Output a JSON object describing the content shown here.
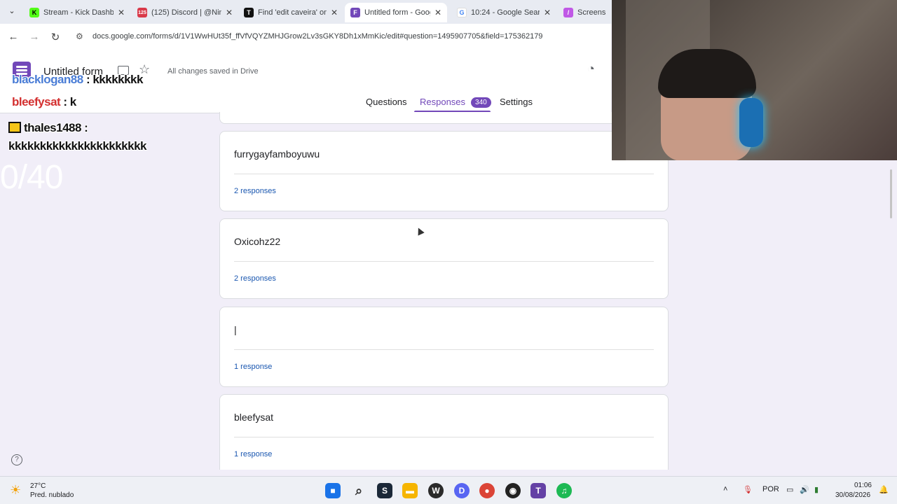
{
  "browser": {
    "tabs": [
      {
        "title": "Stream - Kick Dashbo",
        "fav_color": "#53fc18",
        "glyph": "K"
      },
      {
        "title": "(125) Discord | @Nin",
        "fav_color": "#d93a4a",
        "glyph": "125"
      },
      {
        "title": "Find 'edit caveira' on",
        "fav_color": "#111111",
        "glyph": "T"
      },
      {
        "title": "Untitled form - Goog",
        "fav_color": "#7248b9",
        "glyph": "F"
      },
      {
        "title": "10:24 - Google Searc",
        "fav_color": "#4285f4",
        "glyph": "G"
      },
      {
        "title": "Screenshot",
        "fav_color": "#c058e6",
        "glyph": "/"
      }
    ],
    "url": "docs.google.com/forms/d/1V1WwHUt35f_ffVfVQYZMHJGrow2Lv3sGKY8Dh1xMmKic/edit#question=1495907705&field=175362179"
  },
  "form": {
    "title": "Untitled form",
    "saved_status": "All changes saved in Drive",
    "tabs": {
      "questions": "Questions",
      "responses": "Responses",
      "responses_count": "340",
      "settings": "Settings"
    }
  },
  "overlay": {
    "chat": [
      {
        "user": "blacklogan88",
        "msg": " : kkkkkkkk"
      },
      {
        "user": "bleefysat",
        "msg": " : k"
      },
      {
        "user": "thales1488 :",
        "msg": "kkkkkkkkkkkkkkkkkkkkkk"
      }
    ],
    "goal": "0/40"
  },
  "responses": [
    {
      "question": "furrygayfamboyuwu",
      "count": "2 responses"
    },
    {
      "question": "Oxicohz22",
      "count": "2 responses"
    },
    {
      "question": "|",
      "count": "1 response"
    },
    {
      "question": "bleefysat",
      "count": "1 response"
    }
  ],
  "taskbar": {
    "temperature": "27°C",
    "condition": "Pred. nublado",
    "language": "POR",
    "time": "01:06",
    "date": "30/08/2026",
    "apps": [
      {
        "name": "windows-start",
        "color": "#1a73e8",
        "glyph": "■"
      },
      {
        "name": "search",
        "color": "#333333",
        "glyph": "⌕"
      },
      {
        "name": "steam",
        "color": "#1b2838",
        "glyph": "S"
      },
      {
        "name": "file-explorer",
        "color": "#f6b500",
        "glyph": "▬"
      },
      {
        "name": "wow",
        "color": "#2a2a2a",
        "glyph": "W"
      },
      {
        "name": "discord",
        "color": "#5865f2",
        "glyph": "D"
      },
      {
        "name": "chrome",
        "color": "#db4437",
        "glyph": "●"
      },
      {
        "name": "obs",
        "color": "#222222",
        "glyph": "◉"
      },
      {
        "name": "twitch",
        "color": "#6441a5",
        "glyph": "T"
      },
      {
        "name": "spotify",
        "color": "#1db954",
        "glyph": "♫"
      }
    ]
  }
}
